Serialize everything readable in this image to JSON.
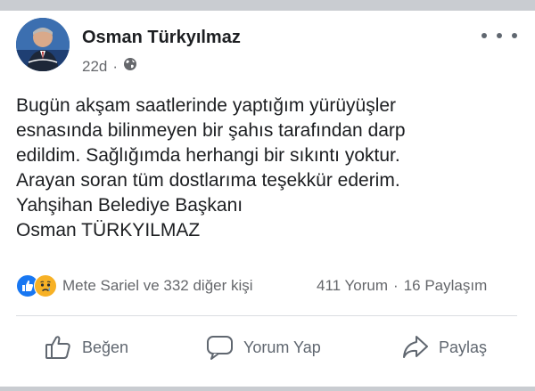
{
  "post": {
    "author": "Osman Türkyılmaz",
    "time": "22d",
    "dot": "·",
    "audience_icon": "globe-icon",
    "lines": [
      "Bugün akşam saatlerinde yaptığım yürüyüşler",
      "esnasında bilinmeyen bir şahıs tarafından darp",
      "edildim. Sağlığımda herhangi bir sıkıntı yoktur.",
      "Arayan soran tüm dostlarıma teşekkür ederim.",
      "Yahşihan Belediye Başkanı",
      "Osman TÜRKYILMAZ"
    ]
  },
  "reactions": {
    "icons": [
      "like-icon",
      "sad-icon"
    ],
    "text": "Mete Sariel ve 332 diğer kişi"
  },
  "counts": {
    "comments": "411 Yorum",
    "sep": "·",
    "shares": "16 Paylaşım"
  },
  "actions": {
    "like": "Beğen",
    "comment": "Yorum Yap",
    "share": "Paylaş"
  },
  "colors": {
    "like_blue": "#1877f2",
    "sad_yellow": "#f7b125",
    "muted": "#65676b"
  }
}
